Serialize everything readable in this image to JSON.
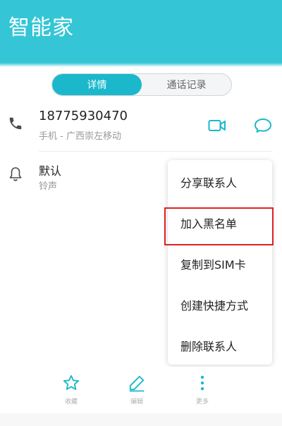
{
  "header": {
    "title": "智能家"
  },
  "tabs": [
    {
      "label": "详情",
      "active": true
    },
    {
      "label": "通话记录",
      "active": false
    }
  ],
  "contact": {
    "phone_number": "18775930470",
    "phone_sub": "手机 - 广西崇左移动",
    "ringtone_title": "默认",
    "ringtone_sub": "铃声"
  },
  "menu": {
    "items": [
      {
        "label": "分享联系人"
      },
      {
        "label": "加入黑名单",
        "highlighted": true
      },
      {
        "label": "复制到SIM卡"
      },
      {
        "label": "创建快捷方式"
      },
      {
        "label": "删除联系人"
      }
    ]
  },
  "bottom_bar": {
    "favorite_label": "收藏",
    "edit_label": "编辑",
    "more_label": "更多"
  },
  "colors": {
    "accent": "#34c6d6",
    "tab_active": "#1bb8cb",
    "highlight_border": "#e0201f"
  }
}
